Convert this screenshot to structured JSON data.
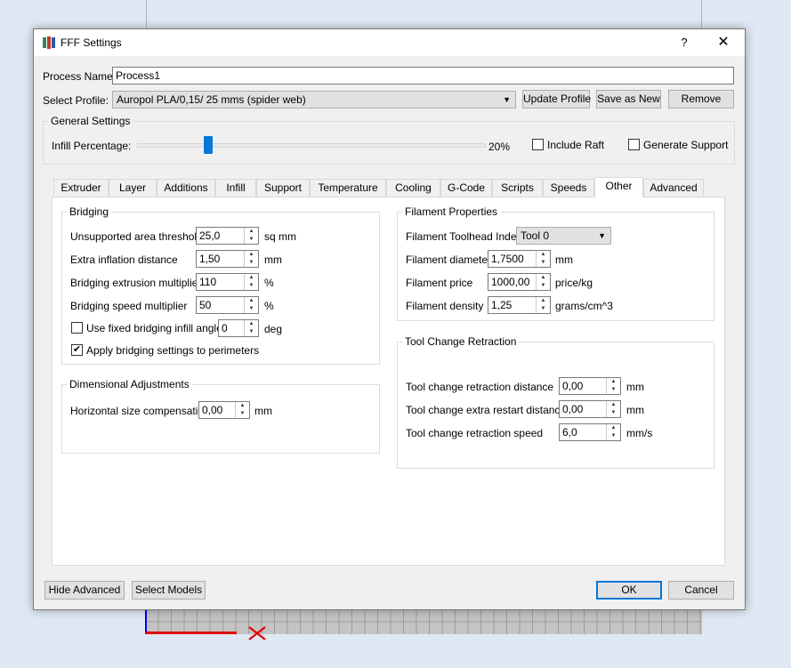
{
  "dialog": {
    "title": "FFF Settings",
    "help_label": "?",
    "close_label": "✕"
  },
  "process_name": {
    "label": "Process Name:",
    "value": "Process1"
  },
  "select_profile": {
    "label": "Select Profile:",
    "value": "Auropol PLA/0,15/ 25 mms (spider web)"
  },
  "profile_buttons": {
    "update": "Update Profile",
    "save_as_new": "Save as New",
    "remove": "Remove"
  },
  "general_settings": {
    "title": "General Settings",
    "infill_label": "Infill Percentage:",
    "infill_value": "20%",
    "infill_level": 20,
    "include_raft": {
      "label": "Include Raft",
      "checked": false
    },
    "generate_support": {
      "label": "Generate Support",
      "checked": false
    }
  },
  "tabs": [
    {
      "label": "Extruder",
      "active": false
    },
    {
      "label": "Layer",
      "active": false
    },
    {
      "label": "Additions",
      "active": false
    },
    {
      "label": "Infill",
      "active": false
    },
    {
      "label": "Support",
      "active": false
    },
    {
      "label": "Temperature",
      "active": false
    },
    {
      "label": "Cooling",
      "active": false
    },
    {
      "label": "G-Code",
      "active": false
    },
    {
      "label": "Scripts",
      "active": false
    },
    {
      "label": "Speeds",
      "active": false
    },
    {
      "label": "Other",
      "active": true
    },
    {
      "label": "Advanced",
      "active": false
    }
  ],
  "bridging": {
    "title": "Bridging",
    "unsupported_area": {
      "label": "Unsupported area threshold",
      "value": "25,0",
      "unit": "sq mm"
    },
    "extra_inflation": {
      "label": "Extra inflation distance",
      "value": "1,50",
      "unit": "mm"
    },
    "extrusion_multiplier": {
      "label": "Bridging extrusion multiplier",
      "value": "110",
      "unit": "%"
    },
    "speed_multiplier": {
      "label": "Bridging speed multiplier",
      "value": "50",
      "unit": "%"
    },
    "fixed_angle": {
      "label": "Use fixed bridging infill angle",
      "checked": false,
      "value": "0",
      "unit": "deg"
    },
    "apply_perimeters": {
      "label": "Apply bridging settings to perimeters",
      "checked": true
    }
  },
  "dimensional": {
    "title": "Dimensional Adjustments",
    "horizontal_comp": {
      "label": "Horizontal size compensation",
      "value": "0,00",
      "unit": "mm"
    }
  },
  "filament": {
    "title": "Filament Properties",
    "toolhead": {
      "label": "Filament Toolhead Index",
      "value": "Tool 0"
    },
    "diameter": {
      "label": "Filament diameter",
      "value": "1,7500",
      "unit": "mm"
    },
    "price": {
      "label": "Filament price",
      "value": "1000,00",
      "unit": "price/kg"
    },
    "density": {
      "label": "Filament density",
      "value": "1,25",
      "unit": "grams/cm^3"
    }
  },
  "tool_change": {
    "title": "Tool Change Retraction",
    "distance": {
      "label": "Tool change retraction distance",
      "value": "0,00",
      "unit": "mm"
    },
    "extra_restart": {
      "label": "Tool change extra restart distance",
      "value": "0,00",
      "unit": "mm"
    },
    "speed": {
      "label": "Tool change retraction speed",
      "value": "6,0",
      "unit": "mm/s"
    }
  },
  "footer": {
    "hide_advanced": "Hide Advanced",
    "select_models": "Select Models",
    "ok": "OK",
    "cancel": "Cancel"
  },
  "colors": {
    "accent": "#0078d7",
    "axis_x": "#e00000",
    "axis_y": "#0000ff"
  }
}
